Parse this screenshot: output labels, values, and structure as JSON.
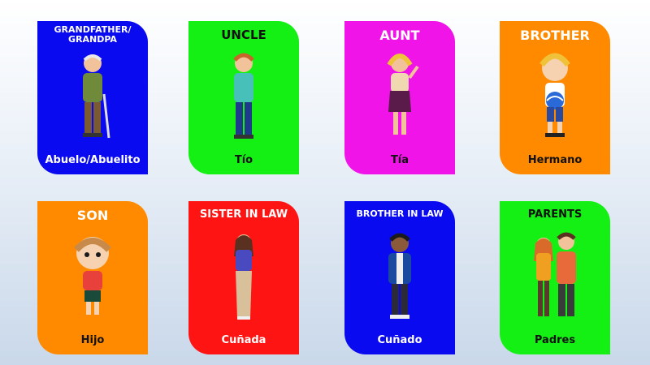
{
  "colors": {
    "blue": "#0a0af0",
    "green": "#14f014",
    "magenta": "#f014e8",
    "orange": "#ff8a00",
    "red": "#ff1414"
  },
  "cards": [
    {
      "title": "GRANDFATHER/ GRANDPA",
      "word": "Abuelo/Abuelito",
      "figure": "grandfather-figure"
    },
    {
      "title": "UNCLE",
      "word": "Tío",
      "figure": "uncle-figure"
    },
    {
      "title": "AUNT",
      "word": "Tía",
      "figure": "aunt-figure"
    },
    {
      "title": "BROTHER",
      "word": "Hermano",
      "figure": "brother-figure"
    },
    {
      "title": "SON",
      "word": "Hijo",
      "figure": "son-figure"
    },
    {
      "title": "SISTER IN LAW",
      "word": "Cuñada",
      "figure": "sister-in-law-figure"
    },
    {
      "title": "BROTHER IN LAW",
      "word": "Cuñado",
      "figure": "brother-in-law-figure"
    },
    {
      "title": "PARENTS",
      "word": "Padres",
      "figure": "parents-figure"
    }
  ]
}
